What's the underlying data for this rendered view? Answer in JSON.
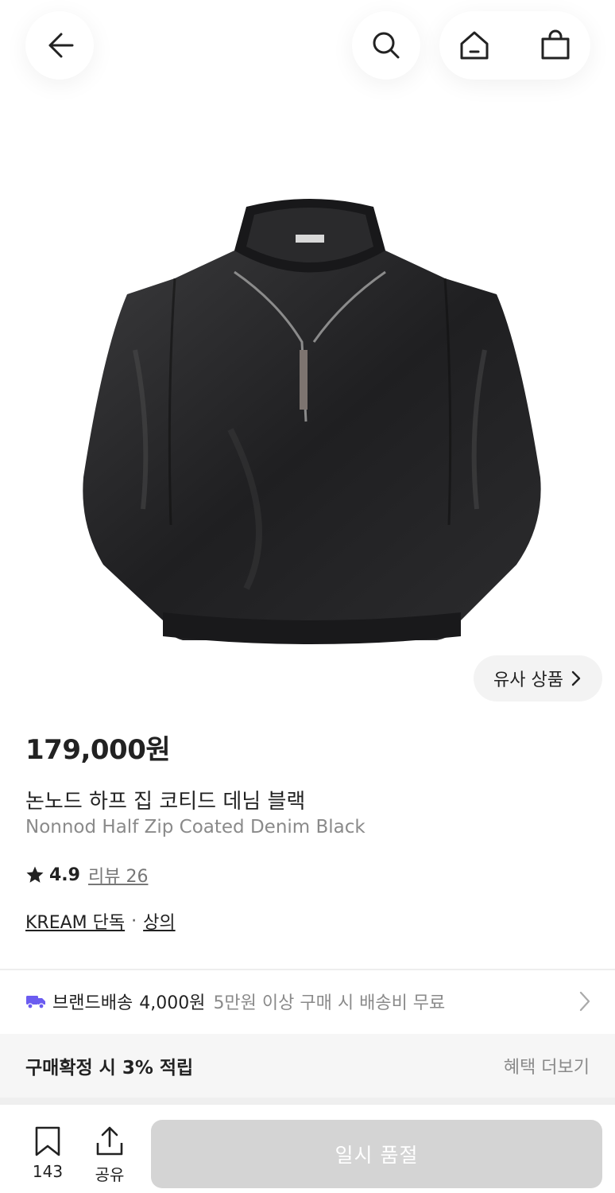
{
  "header": {
    "back_icon": "arrow-left-icon",
    "search_icon": "search-icon",
    "home_icon": "home-icon",
    "bag_icon": "shopping-bag-icon"
  },
  "product": {
    "image_alt": "black coated half-zip jacket",
    "similar_label": "유사 상품",
    "price": "179,000원",
    "name_ko": "논노드 하프 집 코티드 데님 블랙",
    "name_en": "Nonnod Half Zip Coated Denim Black",
    "rating": "4.9",
    "reviews": "리뷰 26",
    "tag_brand": "KREAM 단독",
    "tag_separator": "·",
    "tag_category": "상의"
  },
  "shipping": {
    "label": "브랜드배송",
    "fee": "4,000원",
    "condition": "5만원 이상 구매 시 배송비 무료",
    "accent": "#6b5cf0"
  },
  "benefit": {
    "title": "구매확정 시 3% 적립",
    "more": "혜택 더보기"
  },
  "bottom": {
    "bookmark_count": "143",
    "share_label": "공유",
    "buy_label": "일시 품절"
  }
}
